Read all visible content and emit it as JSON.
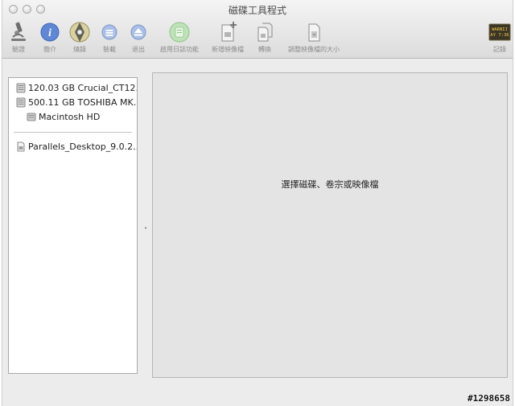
{
  "window": {
    "title": "磁碟工具程式"
  },
  "toolbar": {
    "verify": "驗證",
    "info": "簡介",
    "burn": "燒錄",
    "mount": "裝載",
    "eject": "退出",
    "journal": "啟用日誌功能",
    "new_image": "新增映像檔",
    "convert": "轉換",
    "resize": "調整映像檔的大小",
    "log": "記錄",
    "log_icon_text_1": "WARNII",
    "log_icon_text_2": "AY 7:36"
  },
  "sidebar": {
    "devices": [
      {
        "label": "120.03 GB Crucial_CT12..."
      },
      {
        "label": "500.11 GB TOSHIBA MK..."
      },
      {
        "label": "Macintosh HD"
      },
      {
        "label": "Parallels_Desktop_9.0.2..."
      }
    ]
  },
  "detail": {
    "prompt": "選擇磁碟、卷宗或映像檔"
  },
  "watermark": "#1298658"
}
